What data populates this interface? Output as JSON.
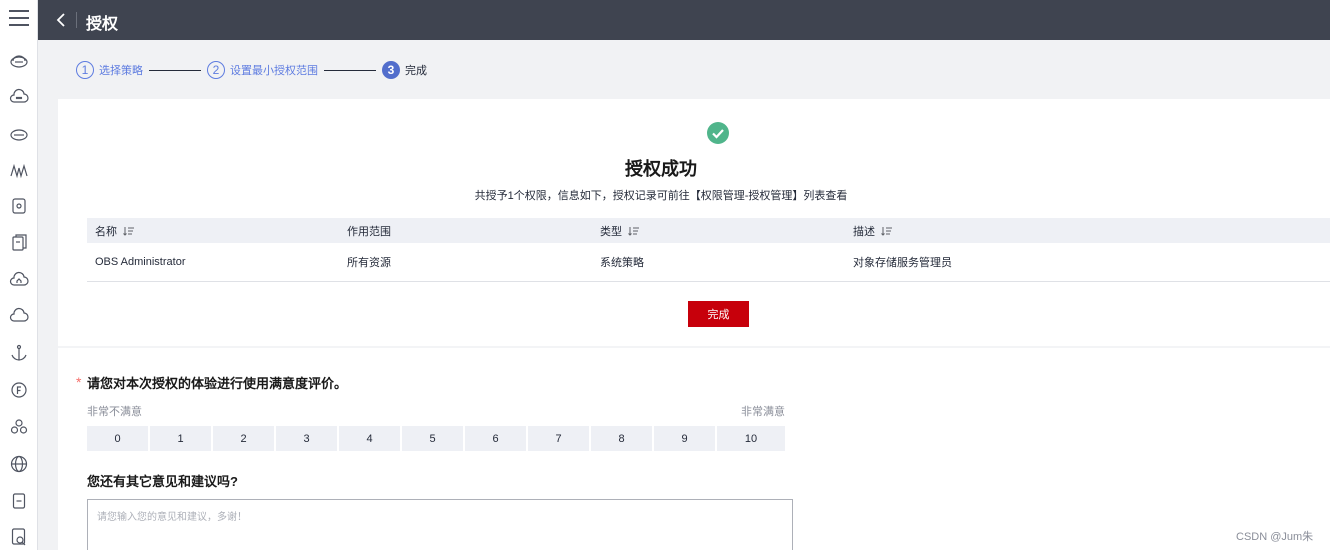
{
  "header": {
    "title": "授权"
  },
  "steps": [
    {
      "num": "1",
      "label": "选择策略"
    },
    {
      "num": "2",
      "label": "设置最小授权范围"
    },
    {
      "num": "3",
      "label": "完成"
    }
  ],
  "result": {
    "title": "授权成功",
    "description": "共授予1个权限，信息如下，授权记录可前往【权限管理-授权管理】列表查看"
  },
  "table": {
    "columns": [
      "名称",
      "作用范围",
      "类型",
      "描述"
    ],
    "rows": [
      [
        "OBS Administrator",
        "所有资源",
        "系统策略",
        "对象存储服务管理员"
      ]
    ]
  },
  "done_button": "完成",
  "survey": {
    "required_mark": "*",
    "question": "请您对本次授权的体验进行使用满意度评价。",
    "low_label": "非常不满意",
    "high_label": "非常满意",
    "scores": [
      "0",
      "1",
      "2",
      "3",
      "4",
      "5",
      "6",
      "7",
      "8",
      "9",
      "10"
    ],
    "feedback_question": "您还有其它意见和建议吗?",
    "feedback_placeholder": "请您输入您的意见和建议，多谢！"
  },
  "watermark": "CSDN @Jum朱",
  "colors": {
    "accent": "#526ecc",
    "primary_button": "#c7000b",
    "success": "#50b58b",
    "topbar": "#3f4450"
  }
}
